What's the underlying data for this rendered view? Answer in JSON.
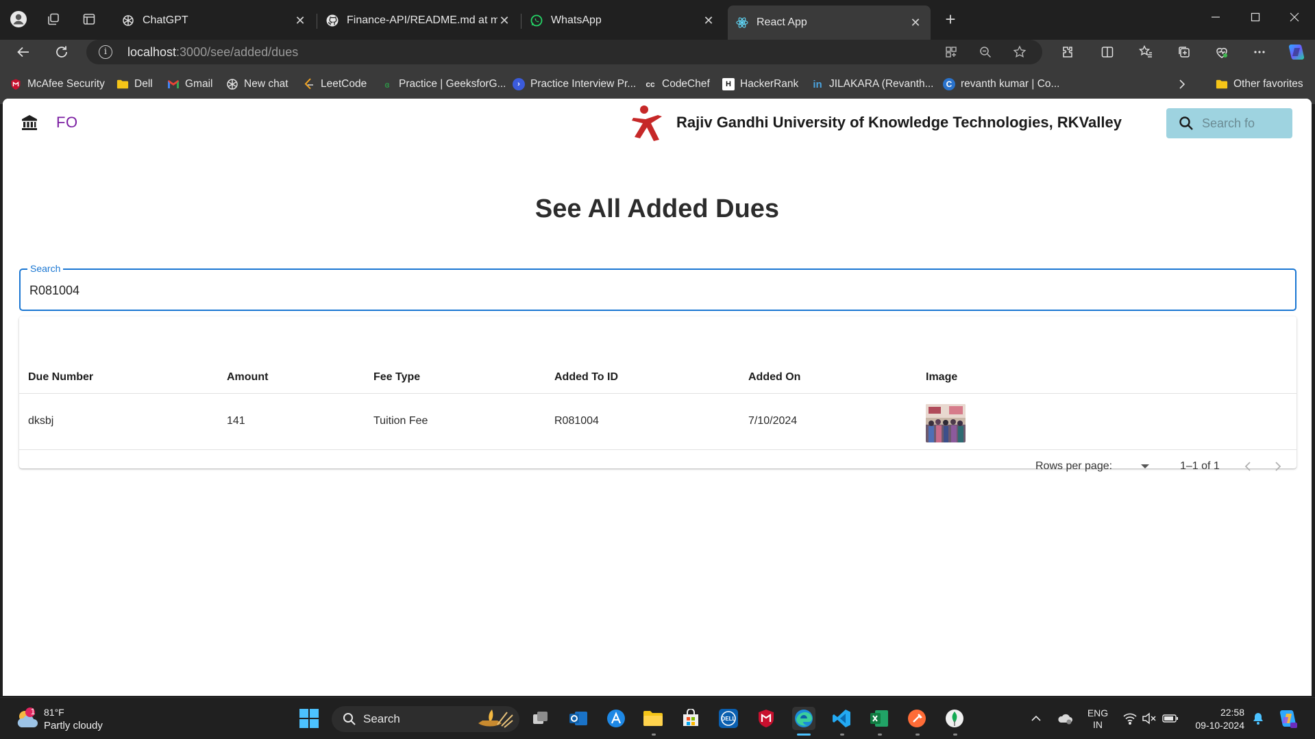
{
  "browser": {
    "tabs": [
      {
        "title": "ChatGPT",
        "icon": "chatgpt-icon"
      },
      {
        "title": "Finance-API/README.md at main",
        "icon": "github-icon"
      },
      {
        "title": "WhatsApp",
        "icon": "whatsapp-icon"
      },
      {
        "title": "React App",
        "icon": "react-icon",
        "active": true
      }
    ],
    "url_host": "localhost",
    "url_path": ":3000/see/added/dues",
    "favorites": [
      {
        "label": "McAfee Security",
        "icon": "mcafee-icon"
      },
      {
        "label": "Dell",
        "icon": "folder-icon"
      },
      {
        "label": "Gmail",
        "icon": "gmail-icon"
      },
      {
        "label": "New chat",
        "icon": "chatgpt-icon"
      },
      {
        "label": "LeetCode",
        "icon": "leetcode-icon"
      },
      {
        "label": "Practice | GeeksforG...",
        "icon": "gfg-icon"
      },
      {
        "label": "Practice Interview Pr...",
        "icon": "interview-icon"
      },
      {
        "label": "CodeChef",
        "icon": "codechef-icon"
      },
      {
        "label": "HackerRank",
        "icon": "hackerrank-icon"
      },
      {
        "label": "JILAKARA (Revanth...",
        "icon": "linkedin-icon"
      },
      {
        "label": "revanth kumar | Co...",
        "icon": "coursera-icon"
      }
    ],
    "other_favorites": "Other favorites",
    "favicon_labels": {
      "codechef": "cc",
      "hackerrank": "H",
      "linkedin": "in",
      "coursera": "C"
    }
  },
  "app": {
    "brand": "FO",
    "university": "Rajiv Gandhi University of Knowledge Technologies, RKValley",
    "search_placeholder": "Search fo",
    "page_title": "See All Added Dues",
    "search_field": {
      "label": "Search",
      "value": "R081004"
    },
    "table": {
      "columns": [
        "Due Number",
        "Amount",
        "Fee Type",
        "Added To ID",
        "Added On",
        "Image"
      ],
      "rows": [
        {
          "due_number": "dksbj",
          "amount": "141",
          "fee_type": "Tuition Fee",
          "added_to_id": "R081004",
          "added_on": "7/10/2024"
        }
      ]
    },
    "pagination": {
      "rows_per_page_label": "Rows per page:",
      "range": "1–1 of 1"
    }
  },
  "taskbar": {
    "weather_temp": "81°F",
    "weather_cond": "Partly cloudy",
    "weather_badge": "1",
    "search_label": "Search",
    "lang": "ENG",
    "region": "IN",
    "time": "22:58",
    "date": "09-10-2024"
  },
  "colors": {
    "accent": "#1976d2",
    "brand": "#7b1fa2",
    "search_bg": "#9ed3e0",
    "logo_red": "#c62828"
  }
}
